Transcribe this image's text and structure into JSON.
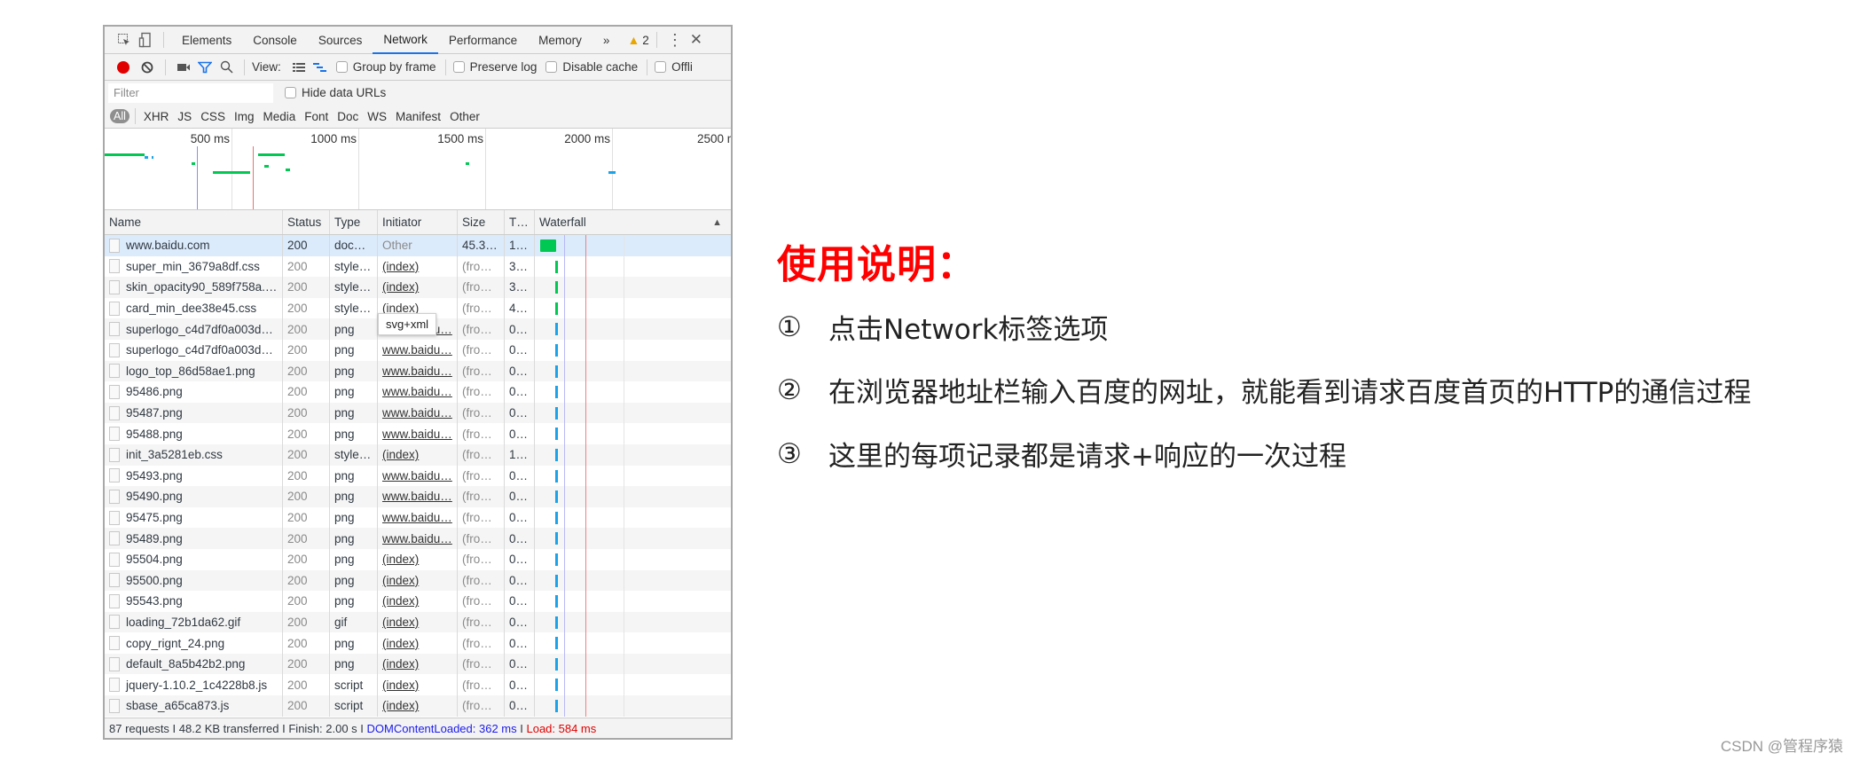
{
  "devtools": {
    "tabs": [
      {
        "label": "Elements",
        "active": false
      },
      {
        "label": "Console",
        "active": false
      },
      {
        "label": "Sources",
        "active": false
      },
      {
        "label": "Network",
        "active": true
      },
      {
        "label": "Performance",
        "active": false
      },
      {
        "label": "Memory",
        "active": false
      }
    ],
    "more_tabs": "»",
    "warning_count": "2",
    "toolbar": {
      "view_label": "View:",
      "group_by_frame": "Group by frame",
      "preserve_log": "Preserve log",
      "disable_cache": "Disable cache",
      "offline": "Offli"
    },
    "filter": {
      "placeholder": "Filter",
      "value": "",
      "hide_data_urls": "Hide data URLs"
    },
    "type_filters": [
      "All",
      "XHR",
      "JS",
      "CSS",
      "Img",
      "Media",
      "Font",
      "Doc",
      "WS",
      "Manifest",
      "Other"
    ],
    "overview": {
      "ticks": [
        "500 ms",
        "1000 ms",
        "1500 ms",
        "2000 ms",
        "2500 m"
      ],
      "dom_content_loaded_ms": 362,
      "load_ms": 584
    },
    "columns": [
      "Name",
      "Status",
      "Type",
      "Initiator",
      "Size",
      "T…",
      "Waterfall"
    ],
    "rows": [
      {
        "name": "www.baidu.com",
        "status": "200",
        "type": "doc…",
        "initiator": "Other",
        "initiator_link": false,
        "size": "45.3…",
        "time": "1…",
        "icon": "document",
        "selected": true
      },
      {
        "name": "super_min_3679a8df.css",
        "status": "200",
        "type": "style…",
        "initiator": "(index)",
        "initiator_link": true,
        "size": "(fro…",
        "time": "3…",
        "icon": "stylesheet"
      },
      {
        "name": "skin_opacity90_589f758a.…",
        "status": "200",
        "type": "style…",
        "initiator": "(index)",
        "initiator_link": true,
        "size": "(fro…",
        "time": "3…",
        "icon": "stylesheet"
      },
      {
        "name": "card_min_dee38e45.css",
        "status": "200",
        "type": "style…",
        "initiator": "(index)",
        "initiator_link": true,
        "size": "(fro…",
        "time": "4…",
        "icon": "stylesheet"
      },
      {
        "name": "superlogo_c4d7df0a003d…",
        "status": "200",
        "type": "png",
        "initiator": "www.baidu…",
        "initiator_link": true,
        "size": "(fro…",
        "time": "0…",
        "icon": "image"
      },
      {
        "name": "superlogo_c4d7df0a003d…",
        "status": "200",
        "type": "png",
        "initiator": "www.baidu…",
        "initiator_link": true,
        "size": "(fro…",
        "time": "0…",
        "icon": "image"
      },
      {
        "name": "logo_top_86d58ae1.png",
        "status": "200",
        "type": "png",
        "initiator": "www.baidu…",
        "initiator_link": true,
        "size": "(fro…",
        "time": "0…",
        "icon": "image"
      },
      {
        "name": "95486.png",
        "status": "200",
        "type": "png",
        "initiator": "www.baidu…",
        "initiator_link": true,
        "size": "(fro…",
        "time": "0…",
        "icon": "image"
      },
      {
        "name": "95487.png",
        "status": "200",
        "type": "png",
        "initiator": "www.baidu…",
        "initiator_link": true,
        "size": "(fro…",
        "time": "0…",
        "icon": "image"
      },
      {
        "name": "95488.png",
        "status": "200",
        "type": "png",
        "initiator": "www.baidu…",
        "initiator_link": true,
        "size": "(fro…",
        "time": "0…",
        "icon": "image"
      },
      {
        "name": "init_3a5281eb.css",
        "status": "200",
        "type": "style…",
        "initiator": "(index)",
        "initiator_link": true,
        "size": "(fro…",
        "time": "1…",
        "icon": "stylesheet"
      },
      {
        "name": "95493.png",
        "status": "200",
        "type": "png",
        "initiator": "www.baidu…",
        "initiator_link": true,
        "size": "(fro…",
        "time": "0…",
        "icon": "image"
      },
      {
        "name": "95490.png",
        "status": "200",
        "type": "png",
        "initiator": "www.baidu…",
        "initiator_link": true,
        "size": "(fro…",
        "time": "0…",
        "icon": "image"
      },
      {
        "name": "95475.png",
        "status": "200",
        "type": "png",
        "initiator": "www.baidu…",
        "initiator_link": true,
        "size": "(fro…",
        "time": "0…",
        "icon": "image"
      },
      {
        "name": "95489.png",
        "status": "200",
        "type": "png",
        "initiator": "www.baidu…",
        "initiator_link": true,
        "size": "(fro…",
        "time": "0…",
        "icon": "image"
      },
      {
        "name": "95504.png",
        "status": "200",
        "type": "png",
        "initiator": "(index)",
        "initiator_link": true,
        "size": "(fro…",
        "time": "0…",
        "icon": "image"
      },
      {
        "name": "95500.png",
        "status": "200",
        "type": "png",
        "initiator": "(index)",
        "initiator_link": true,
        "size": "(fro…",
        "time": "0…",
        "icon": "image"
      },
      {
        "name": "95543.png",
        "status": "200",
        "type": "png",
        "initiator": "(index)",
        "initiator_link": true,
        "size": "(fro…",
        "time": "0…",
        "icon": "image"
      },
      {
        "name": "loading_72b1da62.gif",
        "status": "200",
        "type": "gif",
        "initiator": "(index)",
        "initiator_link": true,
        "size": "(fro…",
        "time": "0…",
        "icon": "image"
      },
      {
        "name": "copy_rignt_24.png",
        "status": "200",
        "type": "png",
        "initiator": "(index)",
        "initiator_link": true,
        "size": "(fro…",
        "time": "0…",
        "icon": "image"
      },
      {
        "name": "default_8a5b42b2.png",
        "status": "200",
        "type": "png",
        "initiator": "(index)",
        "initiator_link": true,
        "size": "(fro…",
        "time": "0…",
        "icon": "image"
      },
      {
        "name": "jquery-1.10.2_1c4228b8.js",
        "status": "200",
        "type": "script",
        "initiator": "(index)",
        "initiator_link": true,
        "size": "(fro…",
        "time": "0…",
        "icon": "script"
      },
      {
        "name": "sbase_a65ca873.js",
        "status": "200",
        "type": "script",
        "initiator": "(index)",
        "initiator_link": true,
        "size": "(fro…",
        "time": "0…",
        "icon": "script"
      }
    ],
    "tooltip": "svg+xml",
    "status_bar": {
      "requests": "87 requests",
      "transferred": "48.2 KB transferred",
      "finish": "Finish: 2.00 s",
      "dom_content_loaded": "DOMContentLoaded: 362 ms",
      "load": "Load: 584 ms",
      "separator": " I "
    },
    "colors": {
      "dom_content_loaded": "#1a1aee",
      "load": "#e00000",
      "waiting": "#00c853",
      "receiving": "#1aa3e8",
      "active_tab": "#1a73e8"
    }
  },
  "instructions": {
    "title": "使用说明：",
    "items": [
      {
        "num": "①",
        "text": "点击Network标签选项"
      },
      {
        "num": "②",
        "text": "在浏览器地址栏输入百度的网址，就能看到请求百度首页的HTTP的通信过程"
      },
      {
        "num": "③",
        "text": "这里的每项记录都是请求+响应的一次过程"
      }
    ]
  },
  "watermark": "CSDN @管程序猿"
}
